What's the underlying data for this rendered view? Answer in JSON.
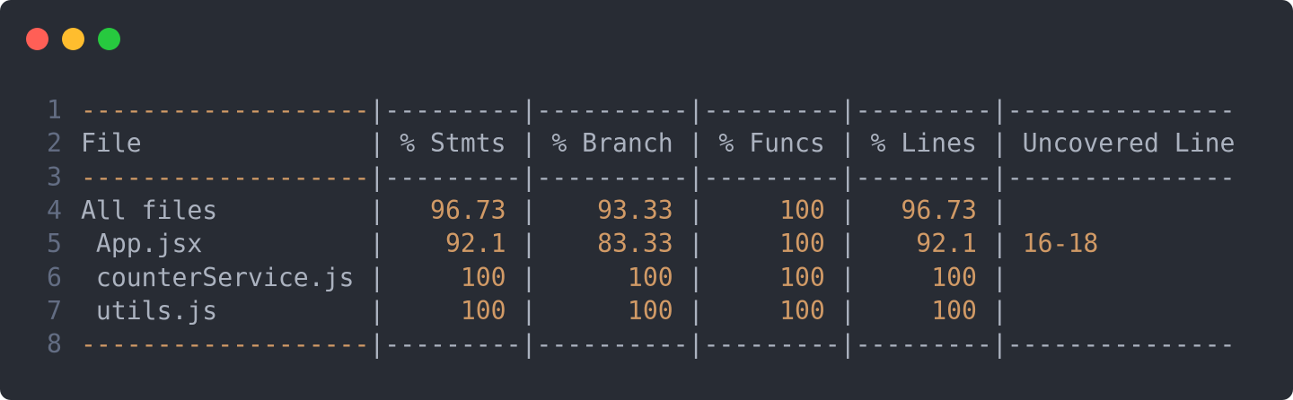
{
  "colors": {
    "window_background": "#282c34",
    "text": "#abb2bf",
    "line_number": "#636d83",
    "accent_orange": "#d19a66",
    "traffic_red": "#ff5f56",
    "traffic_yellow": "#ffbd2e",
    "traffic_green": "#27c93f"
  },
  "window_controls": {
    "close_icon": "close-dot",
    "minimize_icon": "minimize-dot",
    "zoom_icon": "zoom-dot"
  },
  "code_lines": [
    {
      "number": "1",
      "segments": [
        {
          "text": "-------------------",
          "style": "dash-o"
        },
        {
          "text": "|---------|----------|---------|---------|---------------",
          "style": "dim"
        }
      ]
    },
    {
      "number": "2",
      "segments": [
        {
          "text": "File               | % Stmts | % Branch | % Funcs | % Lines | Uncovered Line",
          "style": "dim"
        }
      ]
    },
    {
      "number": "3",
      "segments": [
        {
          "text": "-------------------",
          "style": "dash-o"
        },
        {
          "text": "|---------|----------|---------|---------|---------------",
          "style": "dim"
        }
      ]
    },
    {
      "number": "4",
      "segments": [
        {
          "text": "All files          |   ",
          "style": "dim"
        },
        {
          "text": "96.73",
          "style": "num"
        },
        {
          "text": " |    ",
          "style": "dim"
        },
        {
          "text": "93.33",
          "style": "num"
        },
        {
          "text": " |     ",
          "style": "dim"
        },
        {
          "text": "100",
          "style": "num"
        },
        {
          "text": " |   ",
          "style": "dim"
        },
        {
          "text": "96.73",
          "style": "num"
        },
        {
          "text": " |",
          "style": "dim"
        }
      ]
    },
    {
      "number": "5",
      "segments": [
        {
          "text": " App.jsx           |    ",
          "style": "dim"
        },
        {
          "text": "92.1",
          "style": "num"
        },
        {
          "text": " |    ",
          "style": "dim"
        },
        {
          "text": "83.33",
          "style": "num"
        },
        {
          "text": " |     ",
          "style": "dim"
        },
        {
          "text": "100",
          "style": "num"
        },
        {
          "text": " |    ",
          "style": "dim"
        },
        {
          "text": "92.1",
          "style": "num"
        },
        {
          "text": " | ",
          "style": "dim"
        },
        {
          "text": "16-18",
          "style": "num"
        }
      ]
    },
    {
      "number": "6",
      "segments": [
        {
          "text": " counterService.js |     ",
          "style": "dim"
        },
        {
          "text": "100",
          "style": "num"
        },
        {
          "text": " |      ",
          "style": "dim"
        },
        {
          "text": "100",
          "style": "num"
        },
        {
          "text": " |     ",
          "style": "dim"
        },
        {
          "text": "100",
          "style": "num"
        },
        {
          "text": " |     ",
          "style": "dim"
        },
        {
          "text": "100",
          "style": "num"
        },
        {
          "text": " |",
          "style": "dim"
        }
      ]
    },
    {
      "number": "7",
      "segments": [
        {
          "text": " utils.js          |     ",
          "style": "dim"
        },
        {
          "text": "100",
          "style": "num"
        },
        {
          "text": " |      ",
          "style": "dim"
        },
        {
          "text": "100",
          "style": "num"
        },
        {
          "text": " |     ",
          "style": "dim"
        },
        {
          "text": "100",
          "style": "num"
        },
        {
          "text": " |     ",
          "style": "dim"
        },
        {
          "text": "100",
          "style": "num"
        },
        {
          "text": " |",
          "style": "dim"
        }
      ]
    },
    {
      "number": "8",
      "segments": [
        {
          "text": "-------------------",
          "style": "dash-o"
        },
        {
          "text": "|---------|----------|---------|---------|---------------",
          "style": "dim"
        }
      ]
    }
  ]
}
